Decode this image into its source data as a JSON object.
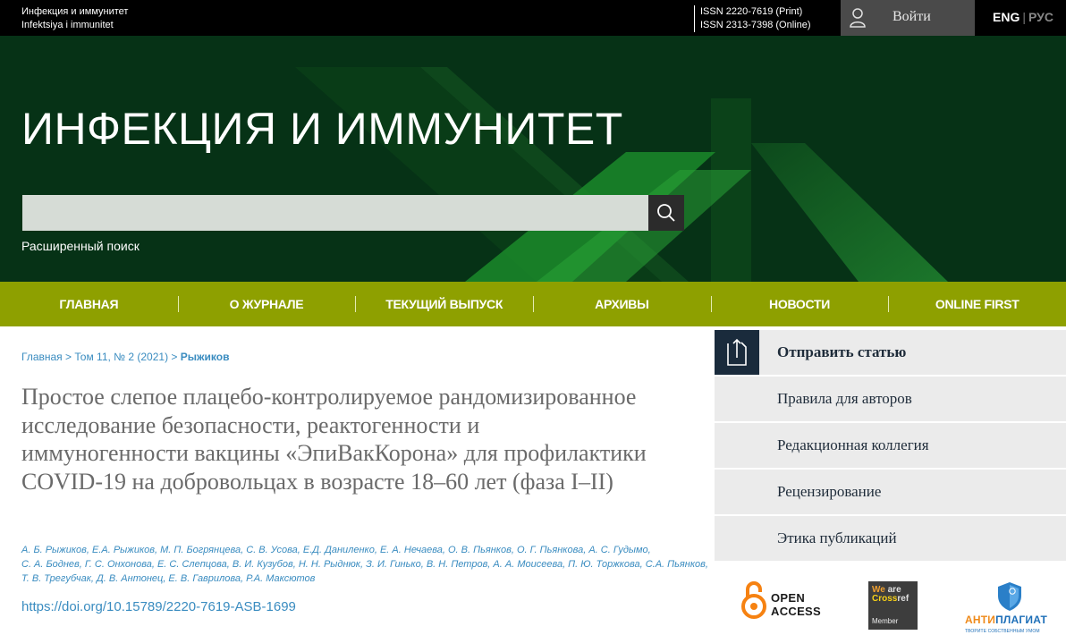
{
  "topbar": {
    "journal_name_ru": "Инфекция и иммунитет",
    "journal_name_lat": "Infektsiya i immunitet",
    "issn_print": "ISSN 2220-7619 (Print)",
    "issn_online": "ISSN 2313-7398 (Online)",
    "login_label": "Войти",
    "lang_eng": "ENG",
    "lang_sep": "|",
    "lang_rus": "РУС"
  },
  "hero": {
    "title": "ИНФЕКЦИЯ И ИММУНИТЕТ",
    "search_value": "",
    "advanced_search": "Расширенный поиск"
  },
  "nav": {
    "items": [
      "ГЛАВНАЯ",
      "О ЖУРНАЛЕ",
      "ТЕКУЩИЙ ВЫПУСК",
      "АРХИВЫ",
      "НОВОСТИ",
      "ONLINE FIRST"
    ]
  },
  "breadcrumb": {
    "home": "Главная",
    "issue": "Том 11, № 2 (2021)",
    "current": "Рыжиков",
    "sep": ">"
  },
  "article": {
    "title": "Простое слепое плацебо-контролируемое рандомизированное исследование безопасности, реактогенности и иммуногенности вакцины «ЭпиВакКорона» для профилактики COVID-19 на добровольцах в возрасте 18–60 лет (фаза I–II)",
    "authors_line1": "А. Б. Рыжиков, Е.А. Рыжиков, М. П. Богрянцева, С. В. Усова, Е.Д. Даниленко, Е. А. Нечаева, О. В. Пьянков, О. Г. Пьянкова, А. С. Гудымо,",
    "authors_line2": "С. А. Боднев, Г. С. Онхонова, Е. С. Слепцова, В. И. Кузубов, Н. Н. Рыднюк, З. И. Гинько, В. Н. Петров, А. А. Моисеева, П. Ю. Торжкова, С.А. Пьянков,",
    "authors_line3": "Т. В. Трегубчак, Д. В. Антонец, Е. В. Гаврилова, Р.А. Максютов",
    "doi": "https://doi.org/10.15789/2220-7619-ASB-1699"
  },
  "sidebar": {
    "submit": "Отправить статью",
    "items": [
      "Правила для авторов",
      "Редакционная коллегия",
      "Рецензирование",
      "Этика публикаций"
    ]
  },
  "logos": {
    "open_access_line1": "OPEN",
    "open_access_line2": "ACCESS",
    "crossref_we": "We",
    "crossref_are": "are",
    "crossref_cross": "Cross",
    "crossref_ref": "ref",
    "crossref_member": "Member",
    "antiplagiat_anti": "АНТИ",
    "antiplagiat_rest": "ПЛАГИАТ",
    "antiplagiat_tagline": "ТВОРИТЕ СОБСТВЕННЫМ УМОМ"
  },
  "colors": {
    "hero_bg": "#063216",
    "nav_bg": "#8ea000",
    "link": "#3a8cc0",
    "submit_icon_bg": "#1a2b3c"
  }
}
